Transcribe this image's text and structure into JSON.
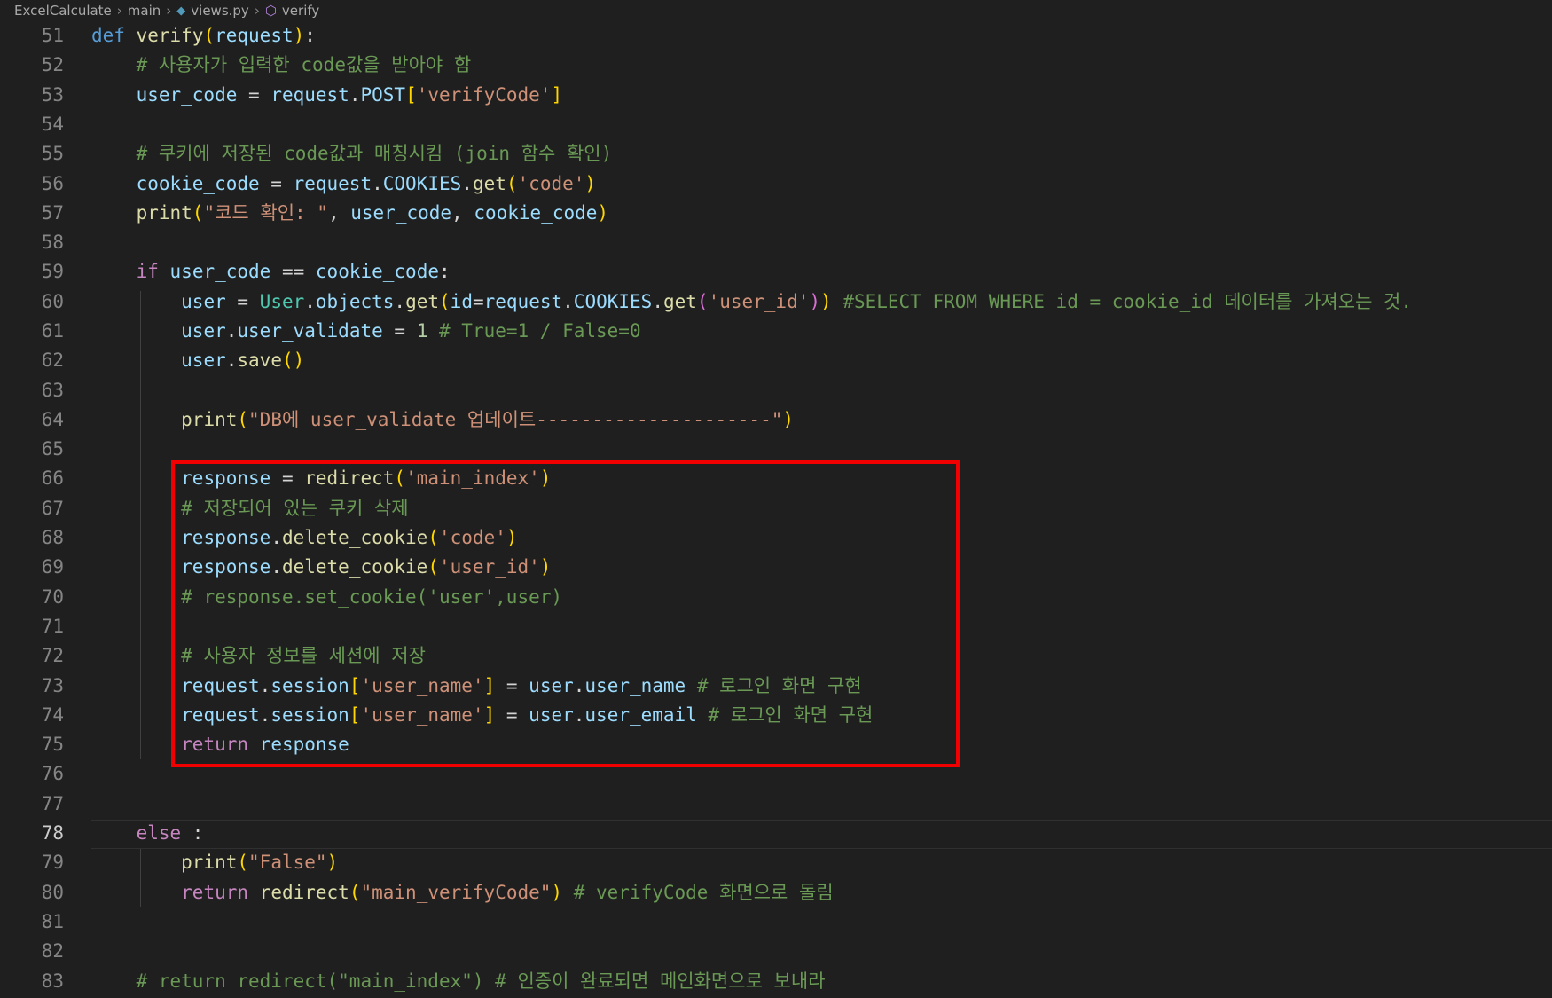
{
  "breadcrumb": {
    "project": "ExcelCalculate",
    "folder": "main",
    "file": "views.py",
    "symbol": "verify"
  },
  "icons": {
    "python_file": "python-file-icon",
    "symbol_method": "method-symbol-icon",
    "separator": "chevron-right-icon"
  },
  "colors": {
    "background": "#1f1f1f",
    "highlight_box": "#f00000",
    "keyword": "#569cd6",
    "control": "#c586c0",
    "function": "#dcdcaa",
    "variable": "#9cdcfe",
    "class": "#4ec9b0",
    "string": "#ce9178",
    "number": "#b5cea8",
    "comment": "#6a9955"
  },
  "active_line": 78,
  "lines": [
    {
      "n": "51",
      "t": [
        [
          "def",
          "kw"
        ],
        [
          " ",
          "op"
        ],
        [
          "verify",
          "fn"
        ],
        [
          "(",
          "p1"
        ],
        [
          "request",
          "var"
        ],
        [
          ")",
          "p1"
        ],
        [
          ":",
          "op"
        ]
      ]
    },
    {
      "n": "52",
      "t": [
        [
          "    ",
          "op"
        ],
        [
          "# 사용자가 입력한 code값을 받아야 함",
          "cmt"
        ]
      ]
    },
    {
      "n": "53",
      "t": [
        [
          "    ",
          "op"
        ],
        [
          "user_code",
          "var"
        ],
        [
          " = ",
          "op"
        ],
        [
          "request",
          "var"
        ],
        [
          ".",
          "op"
        ],
        [
          "POST",
          "var"
        ],
        [
          "[",
          "p1"
        ],
        [
          "'verifyCode'",
          "str"
        ],
        [
          "]",
          "p1"
        ]
      ]
    },
    {
      "n": "54",
      "t": []
    },
    {
      "n": "55",
      "t": [
        [
          "    ",
          "op"
        ],
        [
          "# 쿠키에 저장된 code값과 매칭시킴 (join 함수 확인)",
          "cmt"
        ]
      ]
    },
    {
      "n": "56",
      "t": [
        [
          "    ",
          "op"
        ],
        [
          "cookie_code",
          "var"
        ],
        [
          " = ",
          "op"
        ],
        [
          "request",
          "var"
        ],
        [
          ".",
          "op"
        ],
        [
          "COOKIES",
          "var"
        ],
        [
          ".",
          "op"
        ],
        [
          "get",
          "fn"
        ],
        [
          "(",
          "p1"
        ],
        [
          "'code'",
          "str"
        ],
        [
          ")",
          "p1"
        ]
      ]
    },
    {
      "n": "57",
      "t": [
        [
          "    ",
          "op"
        ],
        [
          "print",
          "fn"
        ],
        [
          "(",
          "p1"
        ],
        [
          "\"코드 확인: \"",
          "str"
        ],
        [
          ", ",
          "op"
        ],
        [
          "user_code",
          "var"
        ],
        [
          ", ",
          "op"
        ],
        [
          "cookie_code",
          "var"
        ],
        [
          ")",
          "p1"
        ]
      ]
    },
    {
      "n": "58",
      "t": []
    },
    {
      "n": "59",
      "t": [
        [
          "    ",
          "op"
        ],
        [
          "if",
          "ctl"
        ],
        [
          " ",
          "op"
        ],
        [
          "user_code",
          "var"
        ],
        [
          " == ",
          "op"
        ],
        [
          "cookie_code",
          "var"
        ],
        [
          ":",
          "op"
        ]
      ]
    },
    {
      "n": "60",
      "t": [
        [
          "        ",
          "op"
        ],
        [
          "user",
          "var"
        ],
        [
          " = ",
          "op"
        ],
        [
          "User",
          "cls"
        ],
        [
          ".",
          "op"
        ],
        [
          "objects",
          "var"
        ],
        [
          ".",
          "op"
        ],
        [
          "get",
          "fn"
        ],
        [
          "(",
          "p1"
        ],
        [
          "id",
          "var"
        ],
        [
          "=",
          "op"
        ],
        [
          "request",
          "var"
        ],
        [
          ".",
          "op"
        ],
        [
          "COOKIES",
          "var"
        ],
        [
          ".",
          "op"
        ],
        [
          "get",
          "fn"
        ],
        [
          "(",
          "p2"
        ],
        [
          "'user_id'",
          "str"
        ],
        [
          ")",
          "p2"
        ],
        [
          ")",
          "p1"
        ],
        [
          " ",
          "op"
        ],
        [
          "#SELECT FROM WHERE id = cookie_id 데이터를 가져오는 것.",
          "cmt"
        ]
      ]
    },
    {
      "n": "61",
      "t": [
        [
          "        ",
          "op"
        ],
        [
          "user",
          "var"
        ],
        [
          ".",
          "op"
        ],
        [
          "user_validate",
          "var"
        ],
        [
          " = ",
          "op"
        ],
        [
          "1",
          "num"
        ],
        [
          " ",
          "op"
        ],
        [
          "# True=1 / False=0",
          "cmt"
        ]
      ]
    },
    {
      "n": "62",
      "t": [
        [
          "        ",
          "op"
        ],
        [
          "user",
          "var"
        ],
        [
          ".",
          "op"
        ],
        [
          "save",
          "fn"
        ],
        [
          "()",
          "p1"
        ]
      ]
    },
    {
      "n": "63",
      "t": []
    },
    {
      "n": "64",
      "t": [
        [
          "        ",
          "op"
        ],
        [
          "print",
          "fn"
        ],
        [
          "(",
          "p1"
        ],
        [
          "\"DB에 user_validate 업데이트---------------------\"",
          "str"
        ],
        [
          ")",
          "p1"
        ]
      ]
    },
    {
      "n": "65",
      "t": []
    },
    {
      "n": "66",
      "t": [
        [
          "        ",
          "op"
        ],
        [
          "response",
          "var"
        ],
        [
          " = ",
          "op"
        ],
        [
          "redirect",
          "fn"
        ],
        [
          "(",
          "p1"
        ],
        [
          "'main_index'",
          "str"
        ],
        [
          ")",
          "p1"
        ]
      ]
    },
    {
      "n": "67",
      "t": [
        [
          "        ",
          "op"
        ],
        [
          "# 저장되어 있는 쿠키 삭제",
          "cmt"
        ]
      ]
    },
    {
      "n": "68",
      "t": [
        [
          "        ",
          "op"
        ],
        [
          "response",
          "var"
        ],
        [
          ".",
          "op"
        ],
        [
          "delete_cookie",
          "fn"
        ],
        [
          "(",
          "p1"
        ],
        [
          "'code'",
          "str"
        ],
        [
          ")",
          "p1"
        ]
      ]
    },
    {
      "n": "69",
      "t": [
        [
          "        ",
          "op"
        ],
        [
          "response",
          "var"
        ],
        [
          ".",
          "op"
        ],
        [
          "delete_cookie",
          "fn"
        ],
        [
          "(",
          "p1"
        ],
        [
          "'user_id'",
          "str"
        ],
        [
          ")",
          "p1"
        ]
      ]
    },
    {
      "n": "70",
      "t": [
        [
          "        ",
          "op"
        ],
        [
          "# response.set_cookie('user',user)",
          "cmt"
        ]
      ]
    },
    {
      "n": "71",
      "t": []
    },
    {
      "n": "72",
      "t": [
        [
          "        ",
          "op"
        ],
        [
          "# 사용자 정보를 세션에 저장",
          "cmt"
        ]
      ]
    },
    {
      "n": "73",
      "t": [
        [
          "        ",
          "op"
        ],
        [
          "request",
          "var"
        ],
        [
          ".",
          "op"
        ],
        [
          "session",
          "var"
        ],
        [
          "[",
          "p1"
        ],
        [
          "'user_name'",
          "str"
        ],
        [
          "]",
          "p1"
        ],
        [
          " = ",
          "op"
        ],
        [
          "user",
          "var"
        ],
        [
          ".",
          "op"
        ],
        [
          "user_name",
          "var"
        ],
        [
          " ",
          "op"
        ],
        [
          "# 로그인 화면 구현",
          "cmt"
        ]
      ]
    },
    {
      "n": "74",
      "t": [
        [
          "        ",
          "op"
        ],
        [
          "request",
          "var"
        ],
        [
          ".",
          "op"
        ],
        [
          "session",
          "var"
        ],
        [
          "[",
          "p1"
        ],
        [
          "'user_name'",
          "str"
        ],
        [
          "]",
          "p1"
        ],
        [
          " = ",
          "op"
        ],
        [
          "user",
          "var"
        ],
        [
          ".",
          "op"
        ],
        [
          "user_email",
          "var"
        ],
        [
          " ",
          "op"
        ],
        [
          "# 로그인 화면 구현",
          "cmt"
        ]
      ]
    },
    {
      "n": "75",
      "t": [
        [
          "        ",
          "op"
        ],
        [
          "return",
          "ctl"
        ],
        [
          " ",
          "op"
        ],
        [
          "response",
          "var"
        ]
      ]
    },
    {
      "n": "76",
      "t": []
    },
    {
      "n": "77",
      "t": []
    },
    {
      "n": "78",
      "t": [
        [
          "    ",
          "op"
        ],
        [
          "else",
          "ctl"
        ],
        [
          " :",
          "op"
        ]
      ]
    },
    {
      "n": "79",
      "t": [
        [
          "        ",
          "op"
        ],
        [
          "print",
          "fn"
        ],
        [
          "(",
          "p1"
        ],
        [
          "\"False\"",
          "str"
        ],
        [
          ")",
          "p1"
        ]
      ]
    },
    {
      "n": "80",
      "t": [
        [
          "        ",
          "op"
        ],
        [
          "return",
          "ctl"
        ],
        [
          " ",
          "op"
        ],
        [
          "redirect",
          "fn"
        ],
        [
          "(",
          "p1"
        ],
        [
          "\"main_verifyCode\"",
          "str"
        ],
        [
          ")",
          "p1"
        ],
        [
          " ",
          "op"
        ],
        [
          "# verifyCode 화면으로 돌림",
          "cmt"
        ]
      ]
    },
    {
      "n": "81",
      "t": []
    },
    {
      "n": "82",
      "t": []
    },
    {
      "n": "83",
      "t": [
        [
          "    ",
          "op"
        ],
        [
          "# return redirect(\"main_index\") # 인증이 완료되면 메인화면으로 보내라",
          "cmt"
        ]
      ]
    }
  ]
}
